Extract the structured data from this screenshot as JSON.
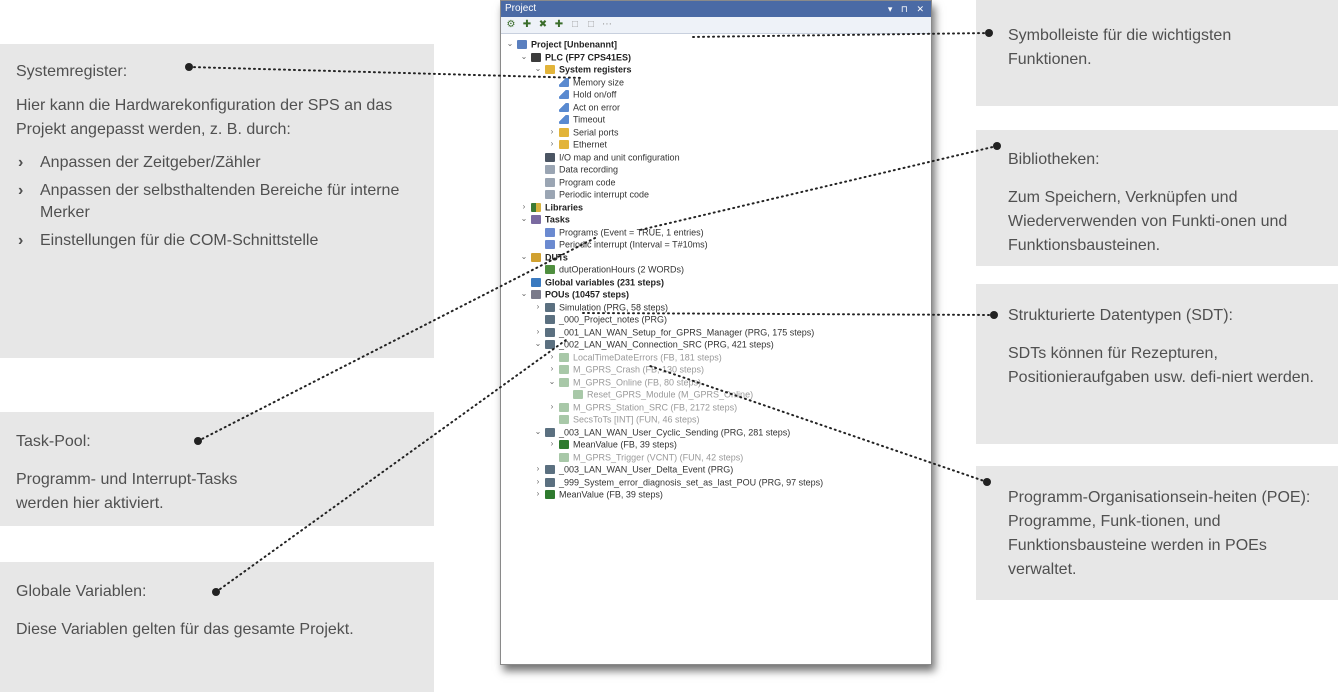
{
  "window": {
    "title": "Project",
    "controls": "▾ ⊓ ✕",
    "toolbar": [
      {
        "name": "settings-icon",
        "glyph": "⚙"
      },
      {
        "name": "add-icon",
        "glyph": "✚"
      },
      {
        "name": "delete-icon",
        "glyph": "✖"
      },
      {
        "name": "new-item-icon",
        "glyph": "✚"
      },
      {
        "name": "collapse-icon",
        "glyph": "□"
      },
      {
        "name": "expand-icon",
        "glyph": "□"
      },
      {
        "name": "more-icon",
        "glyph": "⋯"
      }
    ]
  },
  "tree": [
    {
      "label": "Project [Unbenannt]",
      "level": 0,
      "exp": "⌄",
      "icon": "i-proj",
      "bold": true
    },
    {
      "label": "PLC (FP7 CPS41ES)",
      "level": 1,
      "exp": "⌄",
      "icon": "i-plc",
      "bold": true
    },
    {
      "label": "System registers",
      "level": 2,
      "exp": "⌄",
      "icon": "i-fold",
      "bold": true
    },
    {
      "label": "Memory size",
      "level": 3,
      "exp": "",
      "icon": "i-pen"
    },
    {
      "label": "Hold on/off",
      "level": 3,
      "exp": "",
      "icon": "i-pen"
    },
    {
      "label": "Act on error",
      "level": 3,
      "exp": "",
      "icon": "i-pen"
    },
    {
      "label": "Timeout",
      "level": 3,
      "exp": "",
      "icon": "i-pen"
    },
    {
      "label": "Serial ports",
      "level": 3,
      "exp": "›",
      "icon": "i-fold"
    },
    {
      "label": "Ethernet",
      "level": 3,
      "exp": "›",
      "icon": "i-fold"
    },
    {
      "label": "I/O map and unit configuration",
      "level": 2,
      "exp": "",
      "icon": "i-map"
    },
    {
      "label": "Data recording",
      "level": 2,
      "exp": "",
      "icon": "i-gray"
    },
    {
      "label": "Program code",
      "level": 2,
      "exp": "",
      "icon": "i-gray"
    },
    {
      "label": "Periodic interrupt code",
      "level": 2,
      "exp": "",
      "icon": "i-gray"
    },
    {
      "label": "Libraries",
      "level": 1,
      "exp": "›",
      "icon": "i-lib",
      "bold": true
    },
    {
      "label": "Tasks",
      "level": 1,
      "exp": "⌄",
      "icon": "i-task",
      "bold": true
    },
    {
      "label": "Programs (Event = TRUE, 1 entries)",
      "level": 2,
      "exp": "",
      "icon": "i-tsk2"
    },
    {
      "label": "Periodic interrupt (Interval = T#10ms)",
      "level": 2,
      "exp": "",
      "icon": "i-tsk2"
    },
    {
      "label": "DUTs",
      "level": 1,
      "exp": "⌄",
      "icon": "i-dut",
      "bold": true
    },
    {
      "label": "dutOperationHours (2 WORDs)",
      "level": 2,
      "exp": "",
      "icon": "i-dut2"
    },
    {
      "label": "Global variables (231 steps)",
      "level": 1,
      "exp": "",
      "icon": "i-glob",
      "bold": true
    },
    {
      "label": "POUs (10457 steps)",
      "level": 1,
      "exp": "⌄",
      "icon": "i-pou",
      "bold": true
    },
    {
      "label": "Simulation (PRG, 58 steps)",
      "level": 2,
      "exp": "›",
      "icon": "i-prg"
    },
    {
      "label": "_000_Project_notes (PRG)",
      "level": 2,
      "exp": "",
      "icon": "i-prg"
    },
    {
      "label": "_001_LAN_WAN_Setup_for_GPRS_Manager (PRG, 175 steps)",
      "level": 2,
      "exp": "›",
      "icon": "i-prg"
    },
    {
      "label": "_002_LAN_WAN_Connection_SRC (PRG, 421 steps)",
      "level": 2,
      "exp": "⌄",
      "icon": "i-prg"
    },
    {
      "label": "LocalTimeDateErrors (FB, 181 steps)",
      "level": 3,
      "exp": "›",
      "icon": "i-fb-f",
      "faded": true
    },
    {
      "label": "M_GPRS_Crash (FB, 130 steps)",
      "level": 3,
      "exp": "›",
      "icon": "i-fb-f",
      "faded": true
    },
    {
      "label": "M_GPRS_Online (FB, 80 steps)",
      "level": 3,
      "exp": "⌄",
      "icon": "i-fb-f",
      "faded": true
    },
    {
      "label": "Reset_GPRS_Module (M_GPRS_Online)",
      "level": 4,
      "exp": "",
      "icon": "i-fb-f",
      "faded": true
    },
    {
      "label": "M_GPRS_Station_SRC (FB, 2172 steps)",
      "level": 3,
      "exp": "›",
      "icon": "i-fb-f",
      "faded": true
    },
    {
      "label": "SecsToTs [INT] (FUN, 46 steps)",
      "level": 3,
      "exp": "",
      "icon": "i-fb-f",
      "faded": true
    },
    {
      "label": "_003_LAN_WAN_User_Cyclic_Sending (PRG, 281 steps)",
      "level": 2,
      "exp": "⌄",
      "icon": "i-prg"
    },
    {
      "label": "MeanValue (FB, 39 steps)",
      "level": 3,
      "exp": "›",
      "icon": "i-fb"
    },
    {
      "label": "M_GPRS_Trigger (VCNT) (FUN, 42 steps)",
      "level": 3,
      "exp": "",
      "icon": "i-fb-f",
      "faded": true
    },
    {
      "label": "_003_LAN_WAN_User_Delta_Event (PRG)",
      "level": 2,
      "exp": "›",
      "icon": "i-prg"
    },
    {
      "label": "_999_System_error_diagnosis_set_as_last_POU (PRG, 97 steps)",
      "level": 2,
      "exp": "›",
      "icon": "i-prg"
    },
    {
      "label": "MeanValue (FB, 39 steps)",
      "level": 2,
      "exp": "›",
      "icon": "i-fb"
    }
  ],
  "callouts": {
    "sysreg": {
      "title": "Systemregister:",
      "text": "Hier kann die Hardwarekonfiguration der SPS an das Projekt angepasst werden, z. B. durch:",
      "items": [
        "Anpassen der Zeitgeber/Zähler",
        "Anpassen der selbsthaltenden Bereiche für interne Merker",
        "Einstellungen für die COM-Schnittstelle"
      ],
      "bullet": "›"
    },
    "task": {
      "title": "Task-Pool:",
      "text": "Programm- und Interrupt-Tasks werden hier aktiviert."
    },
    "global": {
      "title": "Globale Variablen:",
      "text": "Diese Variablen gelten für das gesamte Projekt."
    },
    "toolbar": {
      "text": "Symbolleiste für die wichtigsten Funktionen."
    },
    "lib": {
      "title": "Bibliotheken:",
      "text": "Zum Speichern, Verknüpfen und Wiederverwenden von Funkti-onen und Funktionsbausteinen."
    },
    "sdt": {
      "title": "Strukturierte Datentypen (SDT):",
      "text": "SDTs können für Rezepturen, Positionieraufgaben usw. defi-niert werden."
    },
    "poe": {
      "text": "Programm-Organisationsein-heiten (POE): Programme, Funk-tionen, und Funktionsbausteine werden in POEs verwaltet."
    }
  },
  "colors": {
    "callout_bg": "#e7e7e7",
    "text": "#505050",
    "dots": "#222222",
    "titlebar": "#4a6aa5"
  }
}
